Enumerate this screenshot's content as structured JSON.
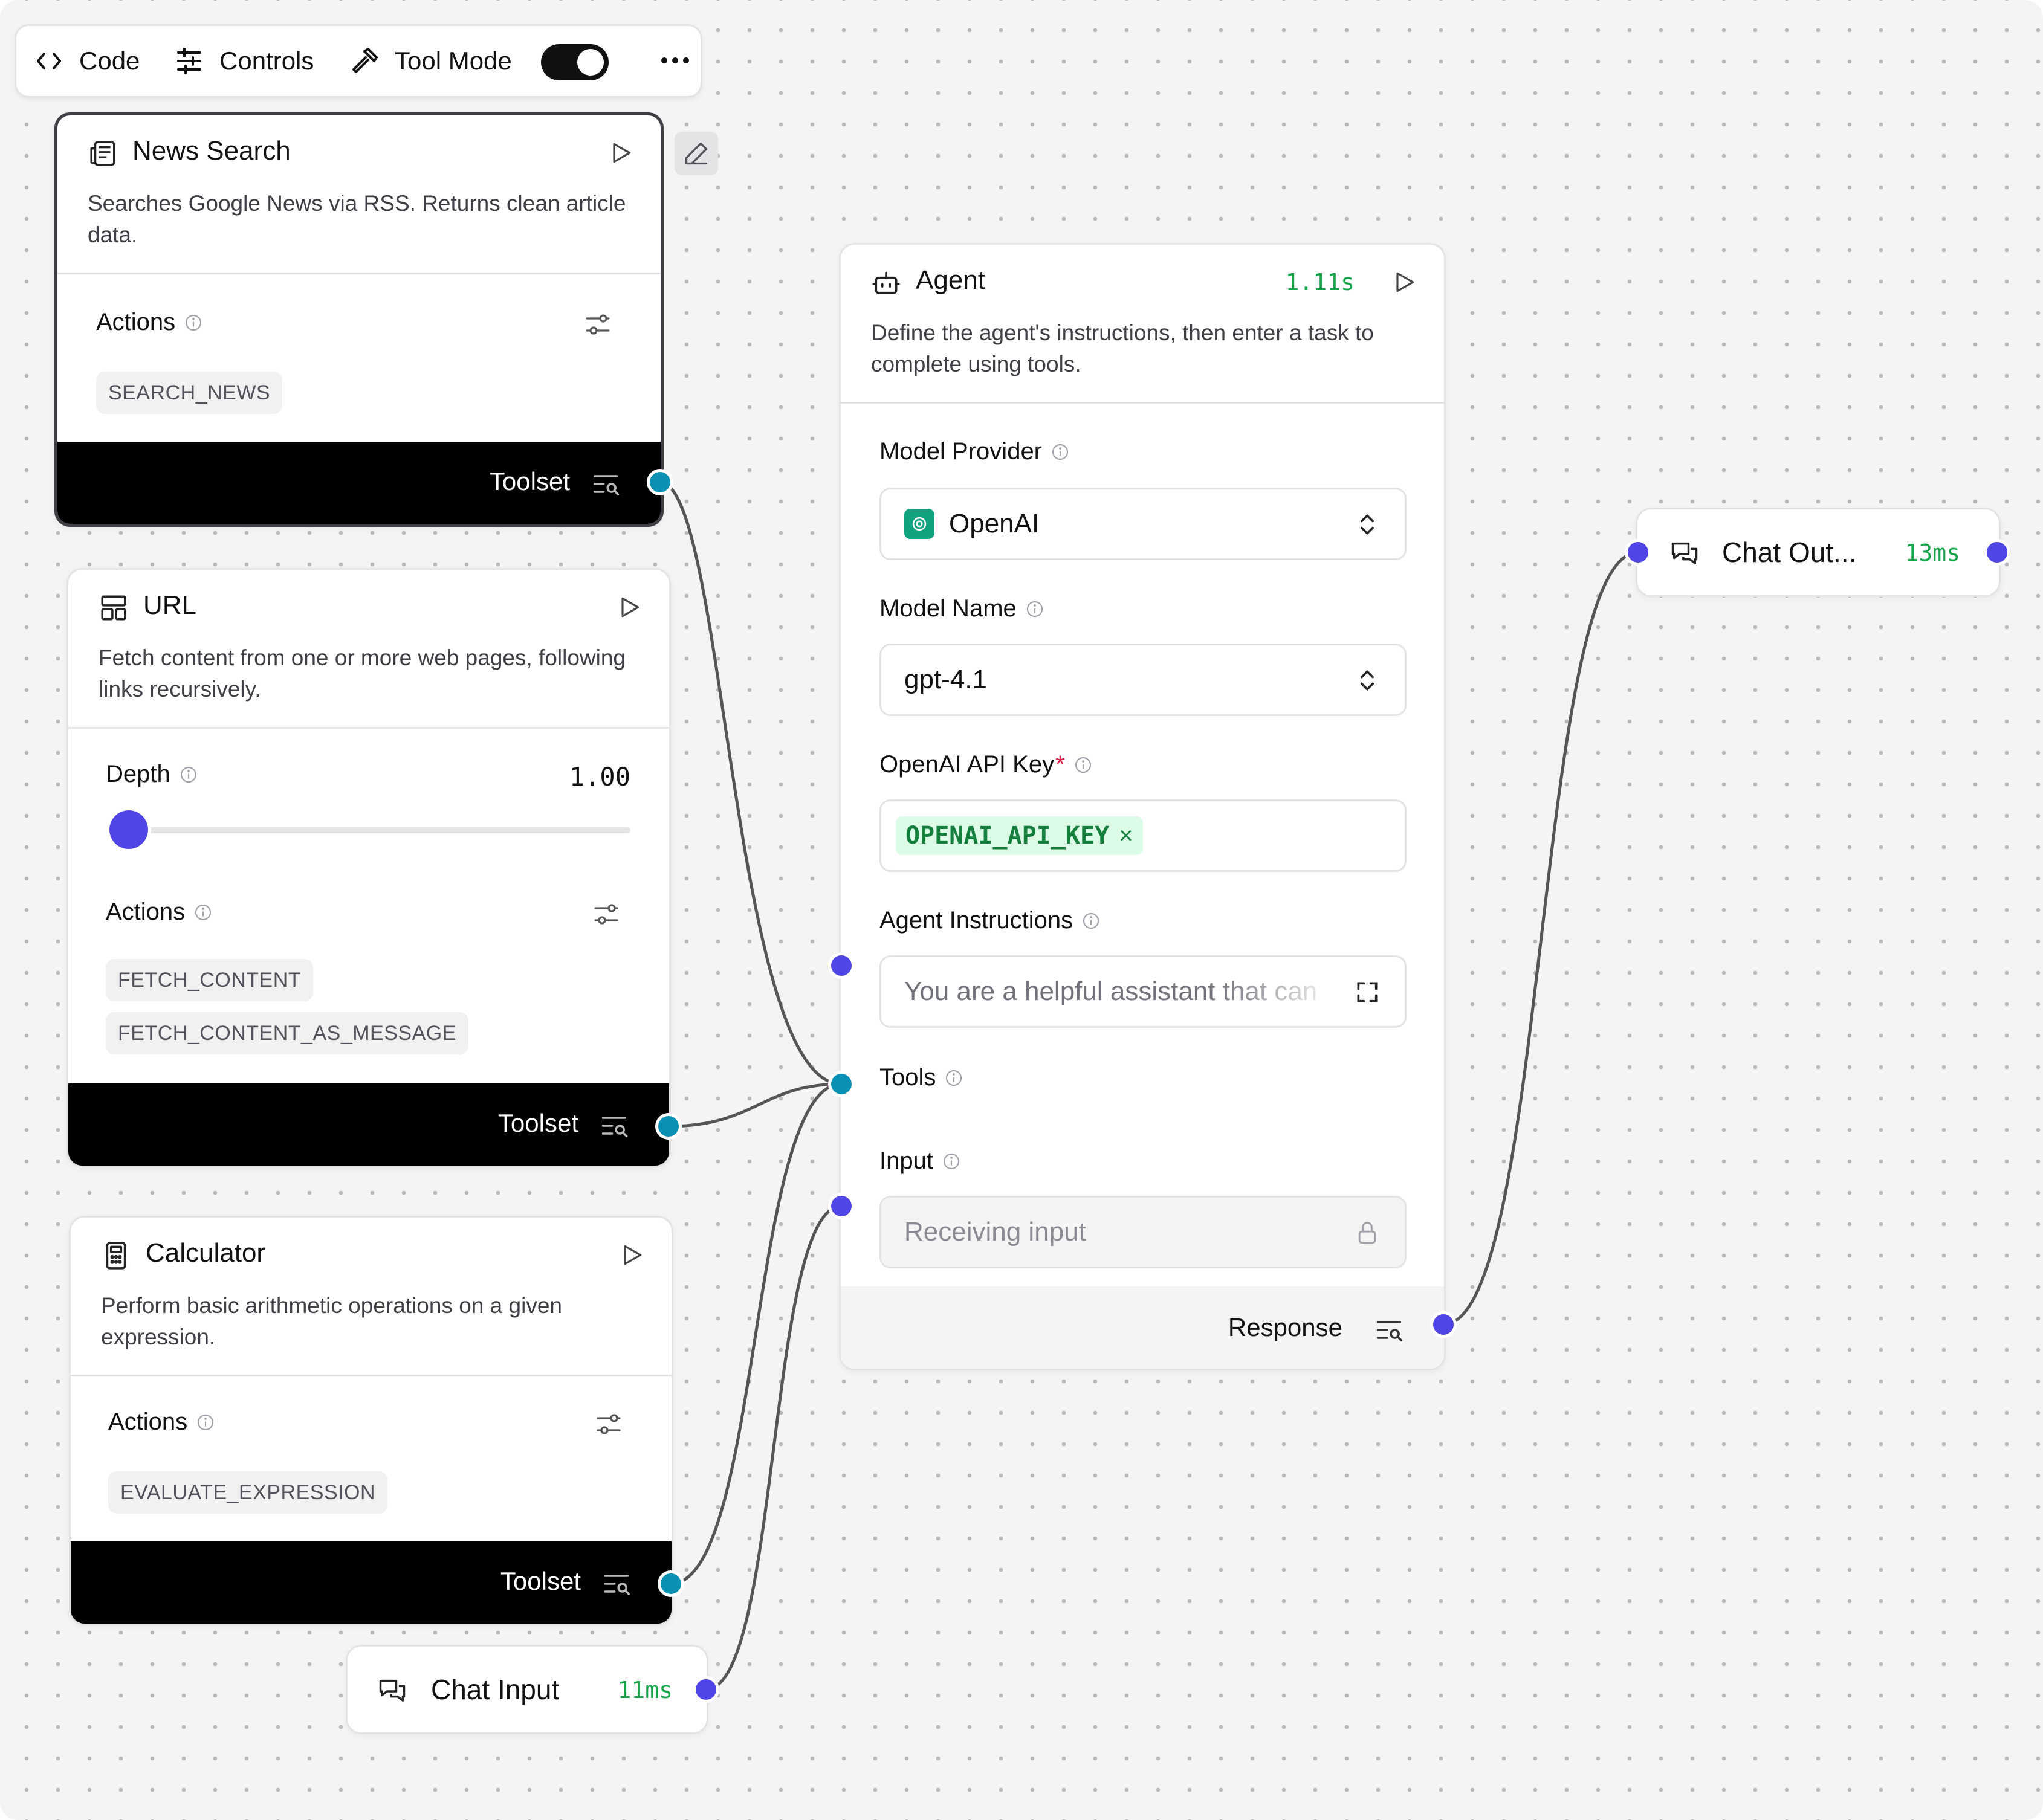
{
  "toolbar": {
    "code_label": "Code",
    "controls_label": "Controls",
    "tool_mode_label": "Tool Mode",
    "tool_mode_on": true
  },
  "nodes": {
    "news_search": {
      "title": "News Search",
      "description": "Searches Google News via RSS. Returns clean article data.",
      "actions_label": "Actions",
      "actions": [
        "SEARCH_NEWS"
      ],
      "toolset_label": "Toolset"
    },
    "url": {
      "title": "URL",
      "description": "Fetch content from one or more web pages, following links recursively.",
      "depth_label": "Depth",
      "depth_value": "1.00",
      "depth_fraction": 0.0,
      "actions_label": "Actions",
      "actions": [
        "FETCH_CONTENT",
        "FETCH_CONTENT_AS_MESSAGE"
      ],
      "toolset_label": "Toolset"
    },
    "calculator": {
      "title": "Calculator",
      "description": "Perform basic arithmetic operations on a given expression.",
      "actions_label": "Actions",
      "actions": [
        "EVALUATE_EXPRESSION"
      ],
      "toolset_label": "Toolset"
    },
    "chat_input": {
      "title": "Chat Input",
      "time": "11ms"
    },
    "agent": {
      "title": "Agent",
      "time": "1.11s",
      "description": "Define the agent's instructions, then enter a task to complete using tools.",
      "model_provider_label": "Model Provider",
      "model_provider_value": "OpenAI",
      "model_name_label": "Model Name",
      "model_name_value": "gpt-4.1",
      "api_key_label": "OpenAI API Key",
      "api_key_required": "*",
      "api_key_value": "OPENAI_API_KEY",
      "api_key_remove": "×",
      "instructions_label": "Agent Instructions",
      "instructions_value": "You are a helpful assistant that can",
      "tools_label": "Tools",
      "input_label": "Input",
      "input_placeholder": "Receiving input",
      "response_label": "Response"
    },
    "chat_output": {
      "title": "Chat Out...",
      "time": "13ms"
    }
  },
  "colors": {
    "accent_indigo": "#4f46e5",
    "handle_teal": "#0891b2",
    "timing_green": "#16a34a",
    "openai_green": "#10a37f"
  }
}
